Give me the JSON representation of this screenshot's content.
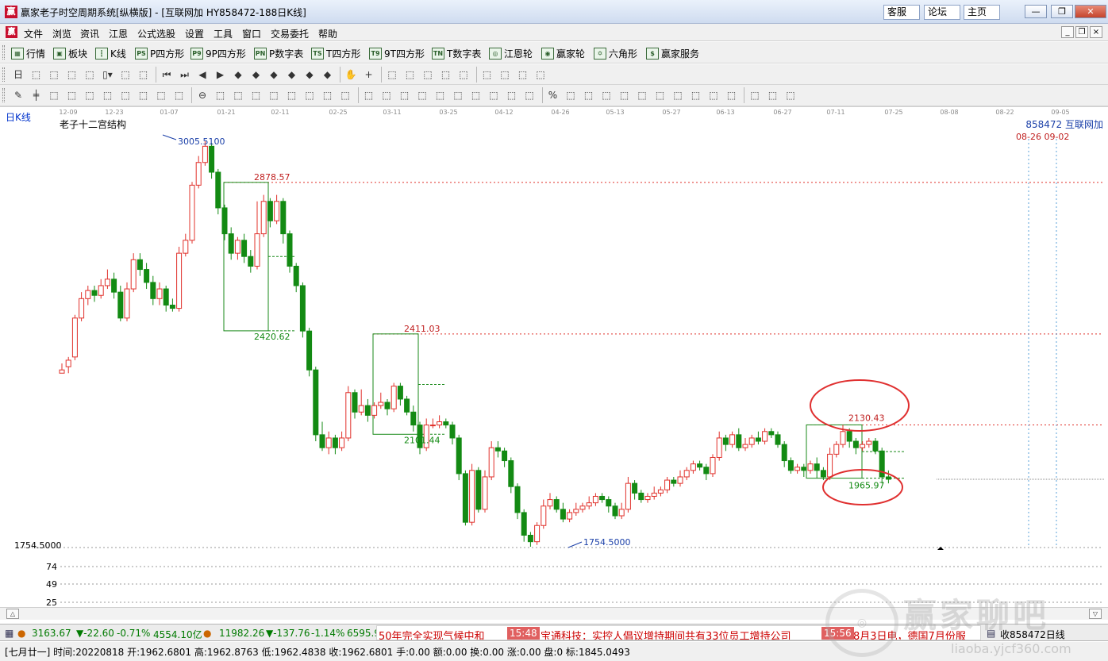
{
  "window": {
    "title": "赢家老子时空周期系统[纵横版] - [互联网加  HY858472-188日K线]",
    "links": [
      "客服",
      "论坛",
      "主页"
    ],
    "controls": {
      "minimize": "—",
      "restore": "❐",
      "close": "✕"
    }
  },
  "menu": {
    "items": [
      "文件",
      "浏览",
      "资讯",
      "江恩",
      "公式选股",
      "设置",
      "工具",
      "窗口",
      "交易委托",
      "帮助"
    ],
    "mdi": [
      "_",
      "❐",
      "×"
    ]
  },
  "toolbar1": {
    "items": [
      {
        "icon": "grid-icon",
        "glyph": "▦",
        "label": "行情"
      },
      {
        "icon": "blocks-icon",
        "glyph": "▣",
        "label": "板块"
      },
      {
        "icon": "candle-icon",
        "glyph": "┇",
        "label": "K线"
      },
      {
        "icon": "ps-icon",
        "glyph": "PS",
        "label": "P四方形"
      },
      {
        "icon": "p9-icon",
        "glyph": "P9",
        "label": "9P四方形"
      },
      {
        "icon": "pn-icon",
        "glyph": "PN",
        "label": "P数字表"
      },
      {
        "icon": "ts-icon",
        "glyph": "TS",
        "label": "T四方形"
      },
      {
        "icon": "t9-icon",
        "glyph": "T9",
        "label": "9T四方形"
      },
      {
        "icon": "tn-icon",
        "glyph": "TN",
        "label": "T数字表"
      },
      {
        "icon": "gann-wheel-icon",
        "glyph": "◎",
        "label": "江恩轮"
      },
      {
        "icon": "winner-wheel-icon",
        "glyph": "◉",
        "label": "赢家轮"
      },
      {
        "icon": "hexagon-icon",
        "glyph": "✡",
        "label": "六角形"
      },
      {
        "icon": "dollar-icon",
        "glyph": "$",
        "label": "赢家服务"
      }
    ]
  },
  "chart": {
    "period": "日K线",
    "indicator": "老子十二宫结构",
    "symbol": "858472  互联网加",
    "future_dates": "08-26 09-02",
    "annotations": [
      {
        "text": "3005.5100"
      },
      {
        "text": "2878.57"
      },
      {
        "text": "2420.62"
      },
      {
        "text": "2411.03"
      },
      {
        "text": "2101.44"
      },
      {
        "text": "2130.43"
      },
      {
        "text": "1965.97"
      },
      {
        "text": "1754.5000"
      }
    ],
    "left_axis_label": "1754.5000",
    "volume_ticks": [
      "74",
      "49",
      "25"
    ]
  },
  "chart_data": {
    "type": "candlestick",
    "x_ticks": [
      "12-09",
      "12-23",
      "01-07",
      "01-21",
      "02-11",
      "02-25",
      "03-11",
      "03-25",
      "04-12",
      "04-26",
      "05-13",
      "05-27",
      "06-13",
      "06-27",
      "07-11",
      "07-25",
      "08-08",
      "08-22",
      "09-05"
    ],
    "high": 3005.51,
    "low": 1754.5,
    "levels": [
      2878.57,
      2411.03,
      2130.43
    ],
    "last_close": 1962.6801,
    "candles": [
      [
        2290,
        2300,
        2320,
        2290
      ],
      [
        2310,
        2330,
        2340,
        2290
      ],
      [
        2340,
        2460,
        2470,
        2330
      ],
      [
        2460,
        2520,
        2540,
        2450
      ],
      [
        2520,
        2545,
        2560,
        2500
      ],
      [
        2545,
        2530,
        2560,
        2510
      ],
      [
        2530,
        2560,
        2580,
        2520
      ],
      [
        2560,
        2580,
        2610,
        2550
      ],
      [
        2580,
        2540,
        2600,
        2520
      ],
      [
        2540,
        2460,
        2560,
        2450
      ],
      [
        2460,
        2550,
        2570,
        2450
      ],
      [
        2550,
        2640,
        2660,
        2540
      ],
      [
        2640,
        2610,
        2660,
        2590
      ],
      [
        2610,
        2570,
        2630,
        2550
      ],
      [
        2570,
        2520,
        2590,
        2500
      ],
      [
        2520,
        2550,
        2570,
        2500
      ],
      [
        2550,
        2500,
        2560,
        2480
      ],
      [
        2500,
        2490,
        2520,
        2480
      ],
      [
        2490,
        2660,
        2680,
        2480
      ],
      [
        2660,
        2700,
        2720,
        2650
      ],
      [
        2700,
        2870,
        2880,
        2690
      ],
      [
        2870,
        2940,
        2960,
        2860
      ],
      [
        2940,
        2990,
        3005.51,
        2930
      ],
      [
        2990,
        2910,
        3000,
        2890
      ],
      [
        2910,
        2800,
        2920,
        2780
      ],
      [
        2800,
        2720,
        2810,
        2700
      ],
      [
        2720,
        2660,
        2740,
        2640
      ],
      [
        2660,
        2700,
        2710,
        2640
      ],
      [
        2700,
        2650,
        2720,
        2630
      ],
      [
        2650,
        2620,
        2670,
        2600
      ],
      [
        2620,
        2720,
        2820,
        2610
      ],
      [
        2720,
        2820,
        2840,
        2710
      ],
      [
        2820,
        2760,
        2830,
        2740
      ],
      [
        2760,
        2820,
        2840,
        2750
      ],
      [
        2820,
        2720,
        2830,
        2690
      ],
      [
        2720,
        2620,
        2730,
        2600
      ],
      [
        2620,
        2560,
        2630,
        2540
      ],
      [
        2560,
        2420,
        2570,
        2400
      ],
      [
        2420,
        2300,
        2430,
        2280
      ],
      [
        2300,
        2100,
        2310,
        2080
      ],
      [
        2100,
        2060,
        2140,
        2050
      ],
      [
        2060,
        2090,
        2110,
        2040
      ],
      [
        2090,
        2060,
        2100,
        2040
      ],
      [
        2060,
        2090,
        2110,
        2050
      ],
      [
        2090,
        2230,
        2250,
        2080
      ],
      [
        2230,
        2170,
        2240,
        2150
      ],
      [
        2170,
        2190,
        2240,
        2160
      ],
      [
        2190,
        2160,
        2210,
        2140
      ],
      [
        2160,
        2190,
        2200,
        2150
      ],
      [
        2190,
        2200,
        2230,
        2180
      ],
      [
        2200,
        2180,
        2210,
        2160
      ],
      [
        2180,
        2250,
        2260,
        2170
      ],
      [
        2250,
        2210,
        2260,
        2190
      ],
      [
        2210,
        2170,
        2220,
        2160
      ],
      [
        2170,
        2130,
        2190,
        2110
      ],
      [
        2130,
        2060,
        2140,
        2040
      ],
      [
        2060,
        2130,
        2150,
        2050
      ],
      [
        2130,
        2130,
        2150,
        2120
      ],
      [
        2130,
        2140,
        2160,
        2120
      ],
      [
        2140,
        2130,
        2150,
        2120
      ],
      [
        2130,
        2090,
        2140,
        2070
      ],
      [
        2090,
        1980,
        2100,
        1960
      ],
      [
        1980,
        1830,
        1990,
        1820
      ],
      [
        1830,
        1990,
        2010,
        1820
      ],
      [
        1990,
        1870,
        2000,
        1860
      ],
      [
        1870,
        1970,
        1990,
        1860
      ],
      [
        1970,
        2060,
        2080,
        1960
      ],
      [
        2060,
        2050,
        2080,
        2030
      ],
      [
        2050,
        2020,
        2060,
        2000
      ],
      [
        2020,
        1940,
        2030,
        1920
      ],
      [
        1940,
        1860,
        1950,
        1840
      ],
      [
        1860,
        1790,
        1870,
        1770
      ],
      [
        1790,
        1770,
        1800,
        1754.5
      ],
      [
        1770,
        1820,
        1830,
        1760
      ],
      [
        1820,
        1880,
        1900,
        1810
      ],
      [
        1880,
        1900,
        1920,
        1870
      ],
      [
        1900,
        1870,
        1910,
        1860
      ],
      [
        1870,
        1840,
        1890,
        1830
      ],
      [
        1840,
        1860,
        1870,
        1830
      ],
      [
        1860,
        1870,
        1890,
        1850
      ],
      [
        1870,
        1880,
        1890,
        1860
      ],
      [
        1880,
        1890,
        1910,
        1870
      ],
      [
        1890,
        1910,
        1920,
        1880
      ],
      [
        1910,
        1900,
        1920,
        1890
      ],
      [
        1900,
        1880,
        1910,
        1860
      ],
      [
        1880,
        1850,
        1890,
        1840
      ],
      [
        1850,
        1870,
        1890,
        1840
      ],
      [
        1870,
        1950,
        1970,
        1860
      ],
      [
        1950,
        1920,
        1960,
        1900
      ],
      [
        1920,
        1900,
        1930,
        1890
      ],
      [
        1900,
        1910,
        1920,
        1890
      ],
      [
        1910,
        1920,
        1940,
        1900
      ],
      [
        1920,
        1930,
        1940,
        1910
      ],
      [
        1930,
        1960,
        1970,
        1920
      ],
      [
        1960,
        1950,
        1970,
        1940
      ],
      [
        1950,
        1970,
        1990,
        1940
      ],
      [
        1970,
        1990,
        2000,
        1960
      ],
      [
        1990,
        2010,
        2020,
        1980
      ],
      [
        2010,
        2000,
        2020,
        1990
      ],
      [
        2000,
        1980,
        2010,
        1960
      ],
      [
        1980,
        2030,
        2040,
        1970
      ],
      [
        2030,
        2090,
        2110,
        2020
      ],
      [
        2090,
        2070,
        2100,
        2050
      ],
      [
        2070,
        2100,
        2110,
        2060
      ],
      [
        2100,
        2060,
        2120,
        2050
      ],
      [
        2060,
        2070,
        2090,
        2050
      ],
      [
        2070,
        2090,
        2100,
        2060
      ],
      [
        2090,
        2080,
        2110,
        2070
      ],
      [
        2080,
        2110,
        2120,
        2070
      ],
      [
        2110,
        2100,
        2120,
        2090
      ],
      [
        2100,
        2070,
        2110,
        2060
      ],
      [
        2070,
        2020,
        2080,
        2000
      ],
      [
        2020,
        1990,
        2030,
        1980
      ],
      [
        1990,
        2000,
        2010,
        1980
      ],
      [
        2000,
        1990,
        2010,
        1970
      ],
      [
        1990,
        2010,
        2020,
        1980
      ],
      [
        2010,
        1990,
        2030,
        1965.97
      ],
      [
        1990,
        1970,
        2000,
        1960
      ],
      [
        1970,
        2040,
        2060,
        1960
      ],
      [
        2040,
        2070,
        2080,
        2030
      ],
      [
        2070,
        2110,
        2130.43,
        2060
      ],
      [
        2110,
        2080,
        2120,
        2060
      ],
      [
        2080,
        2060,
        2090,
        2040
      ],
      [
        2060,
        2070,
        2080,
        2050
      ],
      [
        2070,
        2080,
        2090,
        2060
      ],
      [
        2080,
        2050,
        2090,
        2040
      ],
      [
        2050,
        1970,
        2060,
        1950
      ],
      [
        1970,
        1962.68,
        1990,
        1950
      ]
    ]
  },
  "toolbar2": {
    "tools": [
      "日▾",
      "⬚",
      "⬚",
      "⬚",
      "⬚",
      "▯▾",
      "⬚",
      "⬚",
      "⏮",
      "⏭",
      "◀",
      "▶",
      "◆",
      "◆",
      "◆",
      "◆",
      "◆",
      "◆",
      "✋",
      "+",
      "⬚",
      "⬚",
      "⬚",
      "⬚",
      "⬚",
      "⬚",
      "⬚",
      "⬚",
      "⬚"
    ]
  },
  "toolbar3": {
    "tools": [
      "✎",
      "╪",
      "⬚",
      "⬚",
      "⬚",
      "⬚",
      "⬚",
      "⬚",
      "⬚",
      "⬚",
      "⊖",
      "⬚",
      "⬚",
      "⬚",
      "⬚",
      "⬚",
      "⬚",
      "⬚",
      "⬚",
      "⬚",
      "⬚",
      "⬚",
      "⬚",
      "⬚",
      "⬚",
      "⬚",
      "⬚",
      "⬚",
      "⬚",
      "%",
      "⬚",
      "⬚",
      "⬚",
      "⬚",
      "⬚",
      "⬚",
      "⬚",
      "⬚",
      "⬚",
      "⬚",
      "⬚",
      "⬚",
      "⬚"
    ]
  },
  "status": {
    "sh_index": "3163.67",
    "sh_change": "▼-22.60",
    "sh_pct": "-0.71%",
    "sh_amount": "4554.10亿",
    "sz_index": "11982.26",
    "sz_change": "▼-137.76",
    "sz_pct": "-1.14%",
    "sz_amount": "6595.9",
    "news1": "50年完全实现气候中和",
    "news2_time": "15:48",
    "news2": "宝通科技：实控人倡议增持期间共有33位员工增持公司",
    "news3_time": "15:56",
    "news3": "8月3日电，德国7月份服",
    "right": "收858472日线"
  },
  "info": {
    "text": "[七月廿一] 时间:20220818 开:1962.6801 高:1962.8763 低:1962.4838 收:1962.6801 手:0.00 额:0.00 换:0.00 涨:0.00 盘:0 标:1845.0493"
  },
  "watermark": {
    "text": "赢家聊吧",
    "url": "liaoba.yjcf360.com"
  }
}
